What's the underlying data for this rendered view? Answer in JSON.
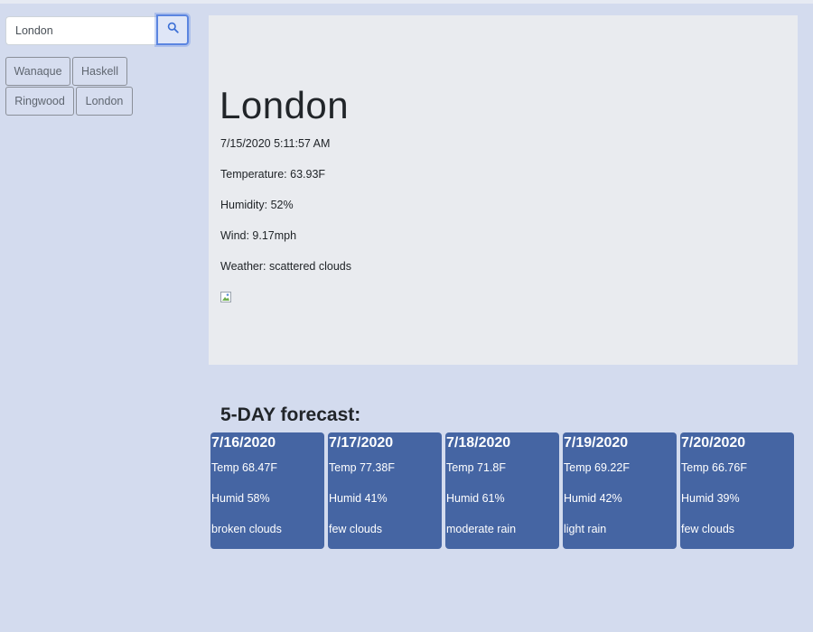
{
  "search": {
    "value": "London",
    "button_icon": "search-icon"
  },
  "history": [
    "Wanaque",
    "Haskell",
    "Ringwood",
    "London"
  ],
  "current": {
    "city": "London",
    "datetime": "7/15/2020 5:11:57 AM",
    "temperature": "Temperature: 63.93F",
    "humidity": "Humidity: 52%",
    "wind": "Wind: 9.17mph",
    "weather": "Weather: scattered clouds",
    "image_icon": "broken-image-icon"
  },
  "forecast": {
    "title": "5-DAY forecast:",
    "days": [
      {
        "date": "7/16/2020",
        "temp": "Temp 68.47F",
        "humid": "Humid 58%",
        "desc": "broken clouds"
      },
      {
        "date": "7/17/2020",
        "temp": "Temp 77.38F",
        "humid": "Humid 41%",
        "desc": "few clouds"
      },
      {
        "date": "7/18/2020",
        "temp": "Temp 71.8F",
        "humid": "Humid 61%",
        "desc": "moderate rain"
      },
      {
        "date": "7/19/2020",
        "temp": "Temp 69.22F",
        "humid": "Humid 42%",
        "desc": "light rain"
      },
      {
        "date": "7/20/2020",
        "temp": "Temp 66.76F",
        "humid": "Humid 39%",
        "desc": "few clouds"
      }
    ]
  },
  "colors": {
    "page_background": "#d3dbee",
    "panel_background": "#e9ebef",
    "card_background": "#4565a3",
    "search_button_accent": "#5b85e0"
  }
}
